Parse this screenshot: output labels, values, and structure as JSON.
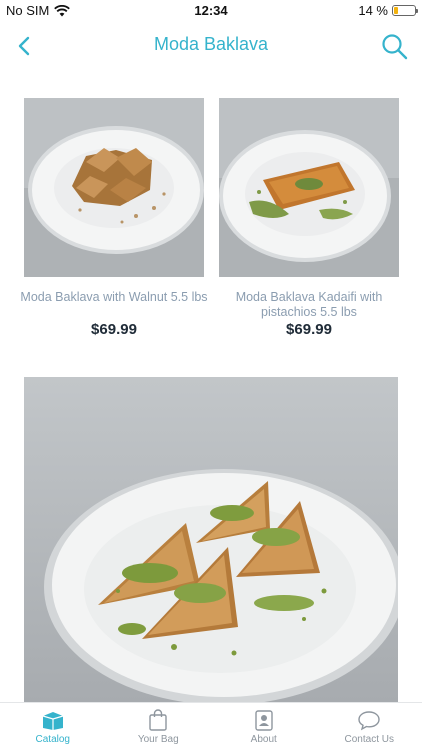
{
  "status": {
    "carrier": "No SIM",
    "time": "12:34",
    "battery": "14 %"
  },
  "nav": {
    "title": "Moda Baklava"
  },
  "products": [
    {
      "name": "Moda Baklava with Walnut 5.5 lbs",
      "price": "$69.99"
    },
    {
      "name": "Moda Baklava Kadaifi with pistachios 5.5 lbs",
      "price": "$69.99"
    }
  ],
  "tabs": [
    {
      "label": "Catalog",
      "icon": "catalog-icon",
      "active": true
    },
    {
      "label": "Your Bag",
      "icon": "bag-icon",
      "active": false
    },
    {
      "label": "About",
      "icon": "about-icon",
      "active": false
    },
    {
      "label": "Contact Us",
      "icon": "chat-icon",
      "active": false
    }
  ],
  "colors": {
    "accent": "#35b3cc",
    "price": "#202c38",
    "name": "#8b9db0"
  }
}
